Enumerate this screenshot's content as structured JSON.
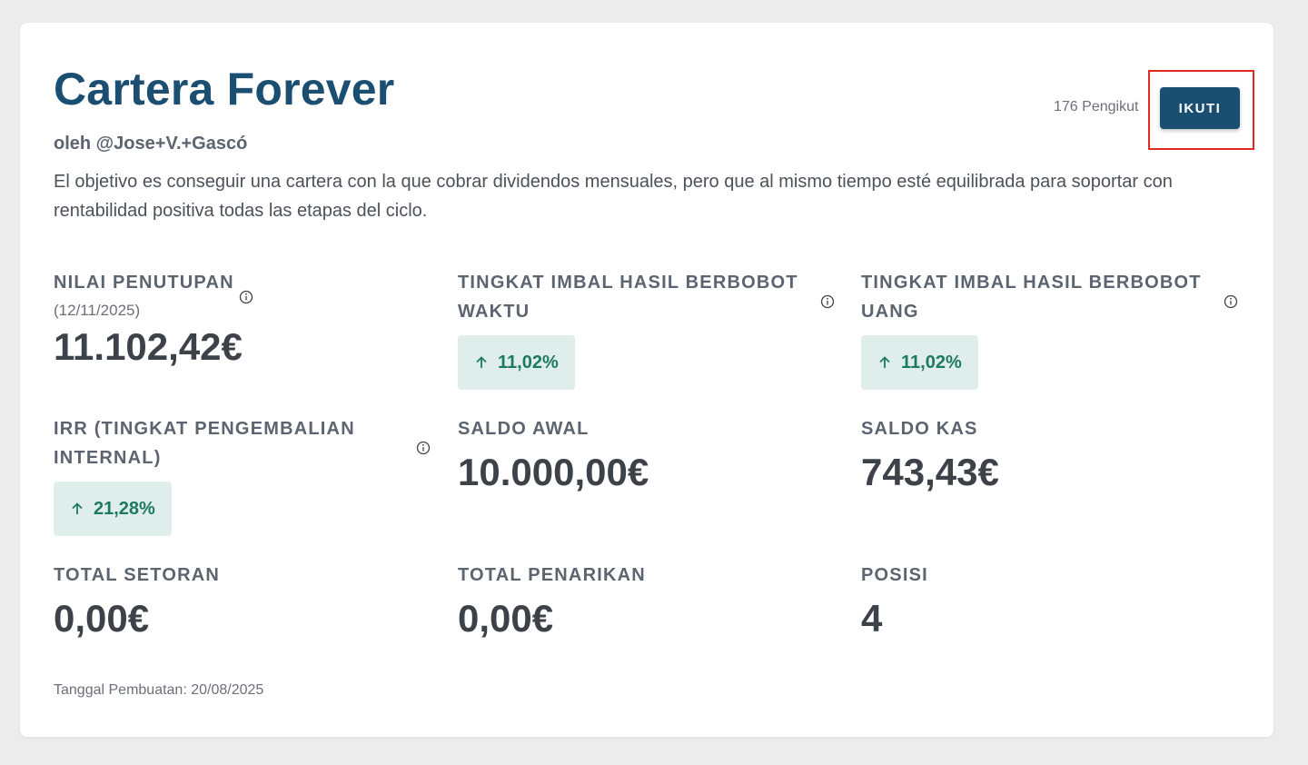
{
  "portfolio": {
    "title": "Cartera Forever",
    "author": "oleh @Jose+V.+Gascó",
    "description": "El objetivo es conseguir una cartera con la que cobrar dividendos mensuales, pero que al mismo tiempo esté equilibrada para soportar con rentabilidad positiva todas las etapas del ciclo.",
    "followers": "176 Pengikut",
    "follow_label": "IKUTI",
    "created": "Tanggal Pembuatan: 20/08/2025"
  },
  "stats": {
    "closing_value": {
      "label": "NILAI PENUTUPAN",
      "sublabel": "(12/11/2025)",
      "value": "11.102,42€"
    },
    "twr": {
      "label": "TINGKAT IMBAL HASIL BERBOBOT WAKTU",
      "value": "11,02%"
    },
    "mwr": {
      "label": "TINGKAT IMBAL HASIL BERBOBOT UANG",
      "value": "11,02%"
    },
    "irr": {
      "label": "IRR (TINGKAT PENGEMBALIAN INTERNAL)",
      "value": "21,28%"
    },
    "opening_balance": {
      "label": "SALDO AWAL",
      "value": "10.000,00€"
    },
    "cash_balance": {
      "label": "SALDO KAS",
      "value": "743,43€"
    },
    "total_deposits": {
      "label": "TOTAL SETORAN",
      "value": "0,00€"
    },
    "total_withdrawals": {
      "label": "TOTAL PENARIKAN",
      "value": "0,00€"
    },
    "positions": {
      "label": "POSISI",
      "value": "4"
    }
  },
  "colors": {
    "brand": "#1b4f72",
    "positive": "#1d7a60",
    "positive_bg": "#dfeeea",
    "highlight": "#e0291f"
  },
  "icons": {
    "info": "info-circle-icon",
    "arrow_up": "arrow-up-icon"
  }
}
